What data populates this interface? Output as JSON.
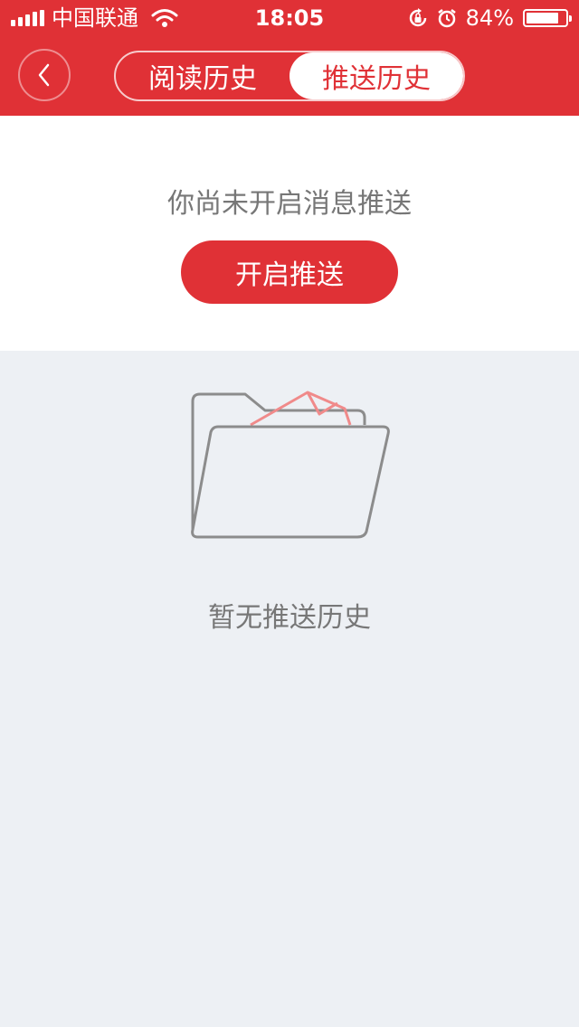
{
  "status_bar": {
    "carrier": "中国联通",
    "time": "18:05",
    "battery_text": "84%",
    "battery_level": 0.84,
    "icons": [
      "signal-icon",
      "wifi-icon",
      "rotation-lock-icon",
      "alarm-icon",
      "battery-icon"
    ]
  },
  "nav": {
    "back_icon": "chevron-left-icon",
    "tabs": [
      {
        "label": "阅读历史",
        "active": false
      },
      {
        "label": "推送历史",
        "active": true
      }
    ]
  },
  "push_panel": {
    "message": "你尚未开启消息推送",
    "button_label": "开启推送"
  },
  "empty_state": {
    "icon": "folder-with-mail-icon",
    "text": "暂无推送历史"
  },
  "colors": {
    "brand_red": "#e03136",
    "background": "#edf0f4",
    "text_gray": "#777777",
    "illustration_gray": "#8c8c8c",
    "illustration_pink": "#f08a8a"
  }
}
